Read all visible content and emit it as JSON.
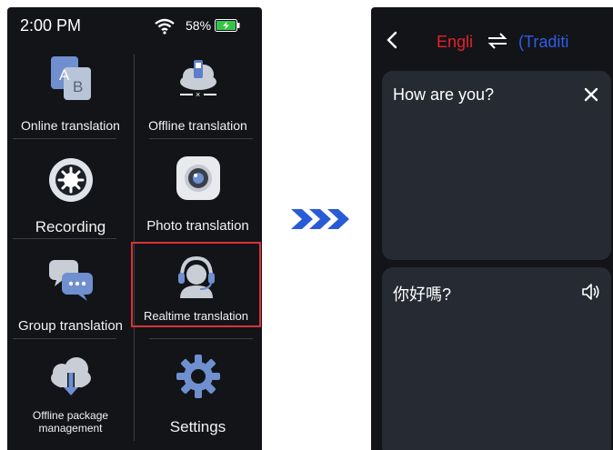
{
  "left_screen": {
    "status": {
      "time": "2:00 PM",
      "battery": "58%"
    },
    "tiles": [
      {
        "label": "Online translation",
        "icon": "translate-ab-icon"
      },
      {
        "label": "Offline translation",
        "icon": "cloud-offline-icon"
      },
      {
        "label": "Recording",
        "icon": "record-icon"
      },
      {
        "label": "Photo translation",
        "icon": "camera-icon"
      },
      {
        "label": "Group translation",
        "icon": "chat-bubbles-icon"
      },
      {
        "label": "Realtime translation",
        "icon": "headset-person-icon",
        "highlighted": true
      },
      {
        "label_line1": "Offline package",
        "label_line2": "management",
        "icon": "cloud-download-icon"
      },
      {
        "label": "Settings",
        "icon": "gear-icon"
      }
    ]
  },
  "right_screen": {
    "source_language": "Engli",
    "target_language": "(Traditi",
    "source_text": "How are you?",
    "translated_text": "你好嗎?"
  },
  "colors": {
    "screen_bg": "#121418",
    "panel_bg": "#262a33",
    "source_lang": "#e8202a",
    "target_lang": "#2f5ee6",
    "highlight_border": "#d9323a",
    "arrow": "#2a5bd7"
  }
}
